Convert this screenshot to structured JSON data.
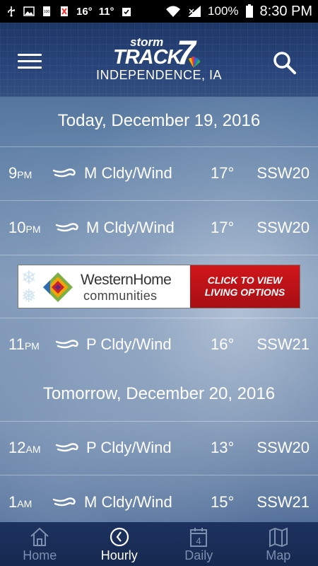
{
  "status_bar": {
    "left_temps": [
      "16°",
      "11°"
    ],
    "battery": "100%",
    "time": "8:30 PM"
  },
  "header": {
    "logo_storm": "storm",
    "logo_track": "TRACK",
    "logo_seven": "7",
    "location": "INDEPENDENCE, IA"
  },
  "dates": [
    "Today, December 19, 2016",
    "Tomorrow, December 20, 2016"
  ],
  "hours": [
    {
      "hour": "9",
      "ampm": "PM",
      "condition": "M Cldy/Wind",
      "temp": "17°",
      "wind": "SSW20",
      "icon": "wind-icon"
    },
    {
      "hour": "10",
      "ampm": "PM",
      "condition": "M Cldy/Wind",
      "temp": "17°",
      "wind": "SSW20",
      "icon": "wind-icon"
    },
    {
      "hour": "11",
      "ampm": "PM",
      "condition": "P Cldy/Wind",
      "temp": "16°",
      "wind": "SSW21",
      "icon": "wind-icon"
    },
    {
      "hour": "12",
      "ampm": "AM",
      "condition": "P Cldy/Wind",
      "temp": "13°",
      "wind": "SSW20",
      "icon": "wind-icon"
    },
    {
      "hour": "1",
      "ampm": "AM",
      "condition": "M Cldy/Wind",
      "temp": "15°",
      "wind": "SSW21",
      "icon": "wind-icon"
    }
  ],
  "ad": {
    "brand": "WesternHome",
    "sub": "communities",
    "cta_line1": "CLICK TO VIEW",
    "cta_line2": "LIVING OPTIONS",
    "cta_color": "#c4141a"
  },
  "bottom_nav": [
    {
      "label": "Home",
      "icon": "home-icon",
      "active": false
    },
    {
      "label": "Hourly",
      "icon": "clock-icon",
      "active": true
    },
    {
      "label": "Daily",
      "icon": "calendar-icon",
      "calendar_number": "4",
      "active": false
    },
    {
      "label": "Map",
      "icon": "map-icon",
      "active": false
    }
  ],
  "colors": {
    "header_bg": "#1e3768",
    "nav_bg": "#1c325f",
    "nav_inactive": "#7d8fae",
    "text": "#ffffff"
  }
}
